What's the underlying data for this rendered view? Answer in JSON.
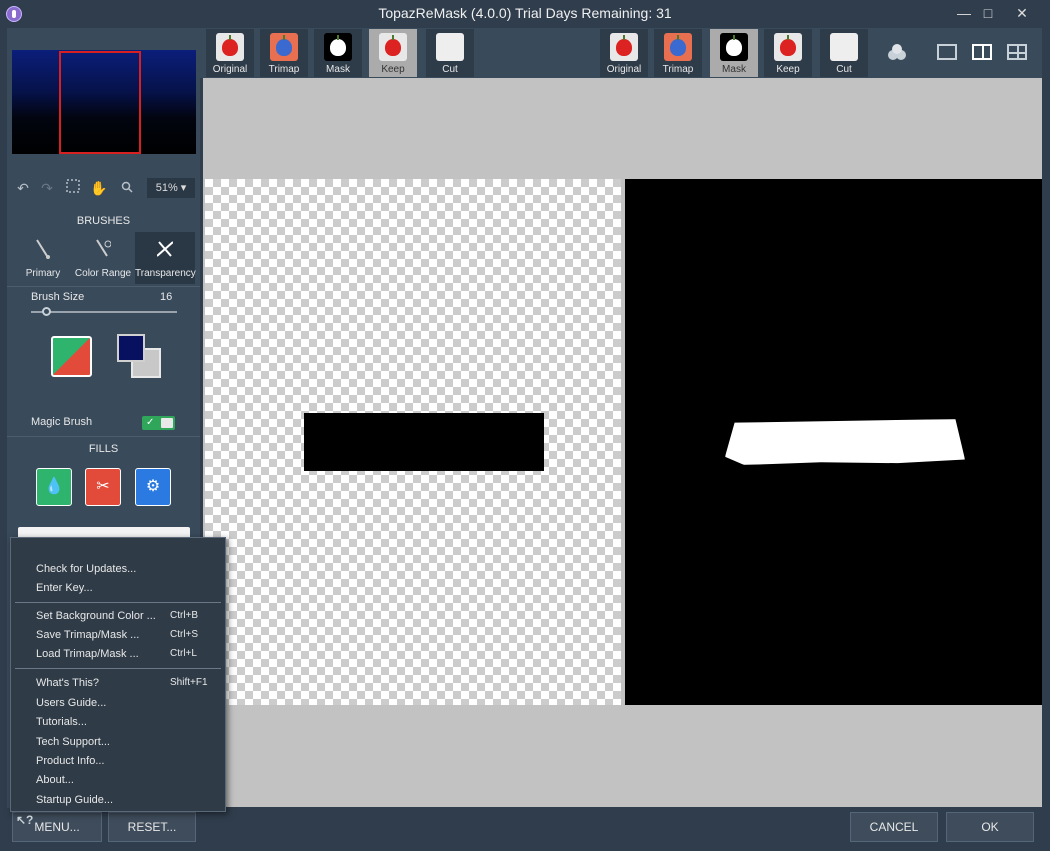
{
  "window": {
    "title": "TopazReMask (4.0.0)     Trial Days Remaining: 31",
    "minimize_glyph": "—",
    "maximize_glyph": "□",
    "close_glyph": "✕"
  },
  "left_panel": {
    "zoom": "51% ▾",
    "brushes_title": "BRUSHES",
    "brushes": [
      {
        "label": "Primary"
      },
      {
        "label": "Color Range"
      },
      {
        "label": "Transparency"
      }
    ],
    "brush_size_label": "Brush Size",
    "brush_size_value": "16",
    "brush_size_fraction": 0.1,
    "foreground_color": "#081060",
    "background_color": "#c8c8c8",
    "magic_brush_label": "Magic Brush",
    "magic_brush_on": true,
    "fills_title": "FILLS",
    "fills": [
      {
        "color": "#2fb46e",
        "icon": "keep-fill-icon"
      },
      {
        "color": "#e24a3a",
        "icon": "cut-fill-icon"
      },
      {
        "color": "#2a7ae2",
        "icon": "recompute-fill-icon"
      }
    ]
  },
  "toolbar": {
    "left_group": [
      {
        "label": "Original"
      },
      {
        "label": "Trimap"
      },
      {
        "label": "Mask"
      },
      {
        "label": "Keep"
      },
      {
        "label": "Cut"
      }
    ],
    "right_group": [
      {
        "label": "Original"
      },
      {
        "label": "Trimap"
      },
      {
        "label": "Mask"
      },
      {
        "label": "Keep"
      },
      {
        "label": "Cut"
      }
    ]
  },
  "menu": {
    "items": [
      {
        "label": "Check for Updates...",
        "shortcut": ""
      },
      {
        "label": "Enter Key...",
        "shortcut": ""
      },
      {
        "label": "Set Background Color ...",
        "shortcut": "Ctrl+B"
      },
      {
        "label": "Save Trimap/Mask ...",
        "shortcut": "Ctrl+S"
      },
      {
        "label": "Load Trimap/Mask ...",
        "shortcut": "Ctrl+L"
      },
      {
        "label": "What's This?",
        "shortcut": "Shift+F1"
      },
      {
        "label": "Users Guide...",
        "shortcut": ""
      },
      {
        "label": "Tutorials...",
        "shortcut": ""
      },
      {
        "label": "Tech Support...",
        "shortcut": ""
      },
      {
        "label": "Product Info...",
        "shortcut": ""
      },
      {
        "label": "About...",
        "shortcut": ""
      },
      {
        "label": "Startup Guide...",
        "shortcut": ""
      }
    ]
  },
  "bottom": {
    "menu_label": "MENU...",
    "reset_label": "RESET...",
    "cancel_label": "CANCEL",
    "ok_label": "OK"
  }
}
